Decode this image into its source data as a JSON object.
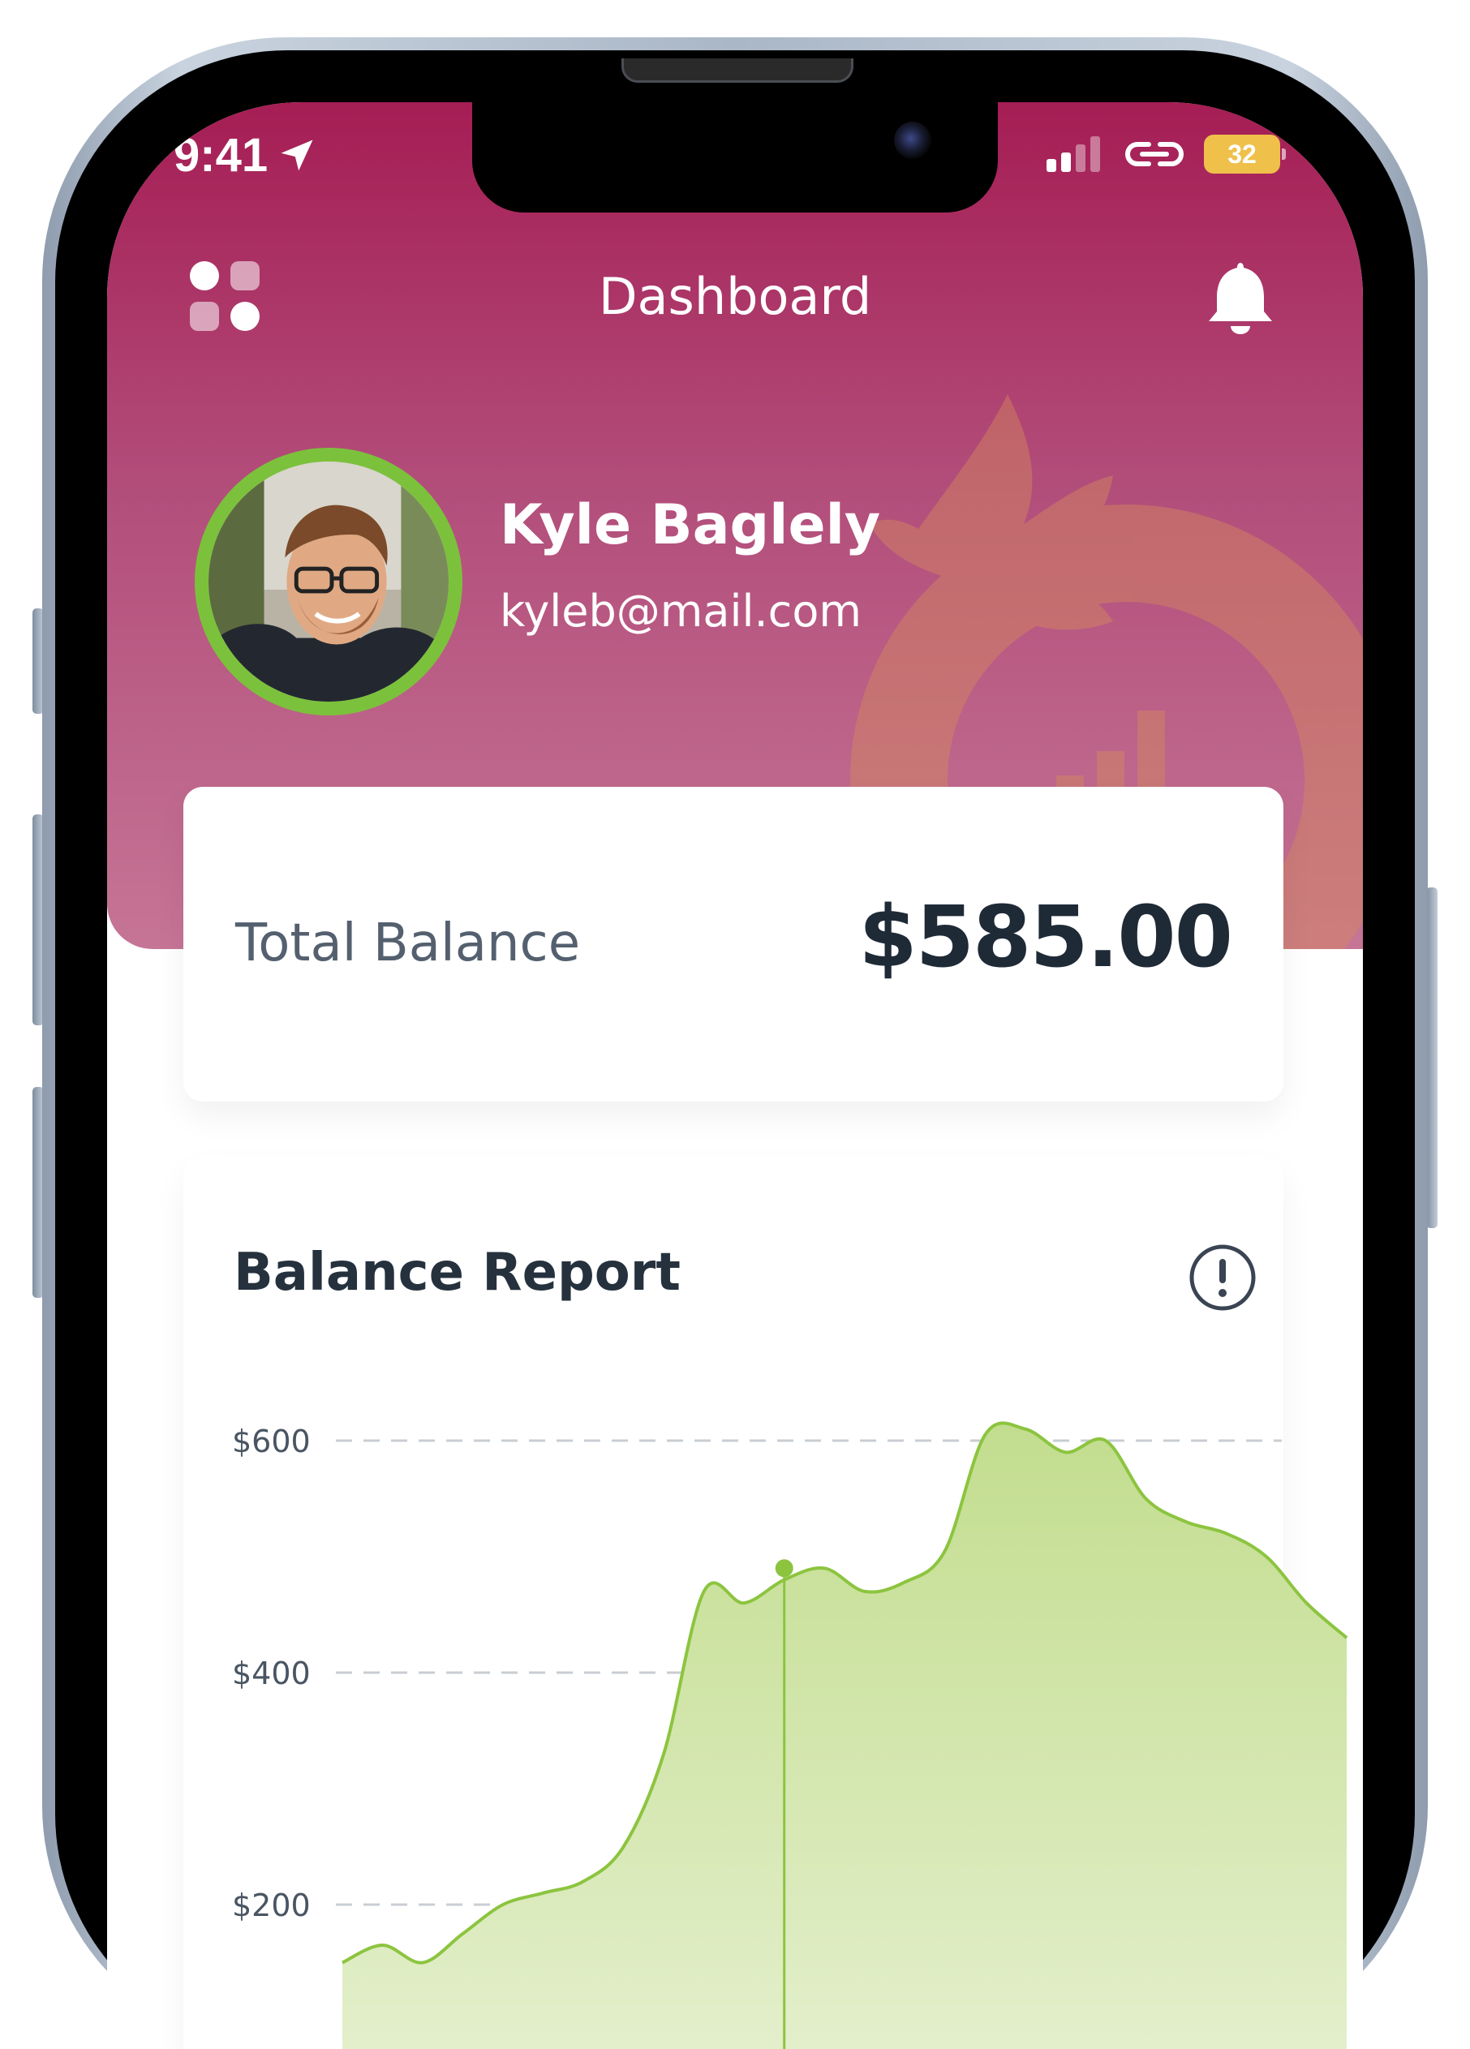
{
  "status_bar": {
    "time": "9:41",
    "battery": "32",
    "icons": [
      "location-arrow-icon",
      "signal-icon",
      "link-icon",
      "battery-icon"
    ]
  },
  "app_bar": {
    "title": "Dashboard",
    "menu_icon": "grid-menu-icon",
    "notification_icon": "bell-icon"
  },
  "profile": {
    "name": "Kyle Baglely",
    "email": "kyleb@mail.com"
  },
  "balance": {
    "label": "Total Balance",
    "value": "$585.00"
  },
  "report": {
    "title": "Balance Report",
    "info_icon": "info-icon"
  },
  "colors": {
    "header_top": "#a51d54",
    "header_bottom": "#c67596",
    "accent_green": "#7cc13c",
    "chart_fill": "#c8e29a",
    "chart_line": "#8cc43f"
  },
  "chart_data": {
    "type": "area",
    "y_tick_labels": [
      "$600",
      "$400",
      "$200"
    ],
    "y_ticks": [
      600,
      400,
      200
    ],
    "ylim": [
      130,
      640
    ],
    "xlim": [
      0,
      25
    ],
    "x": [
      0,
      1,
      2,
      3,
      4,
      5,
      6,
      7,
      8,
      9,
      10,
      11,
      12,
      13,
      14,
      15,
      16,
      17,
      18,
      19,
      20,
      21,
      22,
      23,
      24,
      25
    ],
    "values": [
      150,
      165,
      150,
      175,
      200,
      210,
      220,
      250,
      330,
      470,
      460,
      480,
      490,
      470,
      478,
      505,
      605,
      610,
      590,
      600,
      550,
      530,
      520,
      500,
      460,
      430
    ],
    "highlight": {
      "x": 11,
      "y": 490
    },
    "grid": true,
    "grid_style": "dashed"
  }
}
